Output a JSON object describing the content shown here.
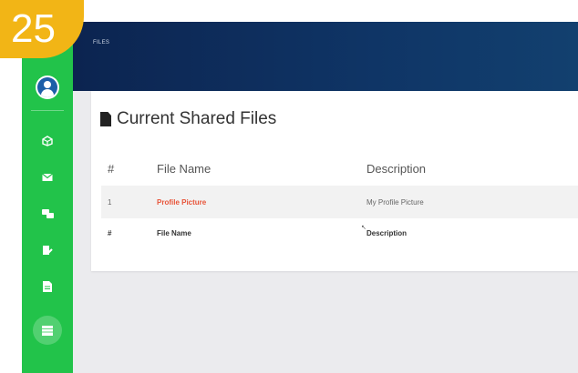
{
  "step_badge": "25",
  "topbar": {
    "breadcrumb": "FILES"
  },
  "sidebar": {
    "items": [
      {
        "icon": "cube-icon"
      },
      {
        "icon": "mail-icon"
      },
      {
        "icon": "chat-icon"
      },
      {
        "icon": "edit-doc-icon"
      },
      {
        "icon": "document-icon"
      },
      {
        "icon": "table-icon",
        "active": true
      }
    ]
  },
  "card": {
    "title": "Current Shared Files",
    "columns": [
      "#",
      "File Name",
      "Description"
    ],
    "rows": [
      {
        "num": "1",
        "file_name": "Profile Picture",
        "description": "My Profile Picture"
      }
    ],
    "footer": [
      "#",
      "File Name",
      "Description"
    ]
  },
  "colors": {
    "sidebar": "#22c34a",
    "topbar": "#0c2450",
    "badge": "#f2b516",
    "link": "#e8553a"
  }
}
